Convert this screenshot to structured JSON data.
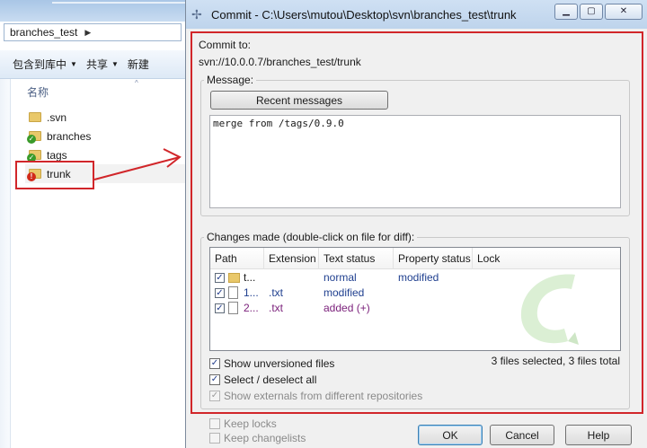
{
  "explorer": {
    "breadcrumb": "branches_test",
    "toolbar": [
      {
        "label": "包含到库中"
      },
      {
        "label": "共享"
      },
      {
        "label": "新建"
      }
    ],
    "column_name": "名称",
    "items": [
      {
        "name": ".svn",
        "status": "none"
      },
      {
        "name": "branches",
        "status": "ok"
      },
      {
        "name": "tags",
        "status": "ok"
      },
      {
        "name": "trunk",
        "status": "modified"
      }
    ]
  },
  "dialog": {
    "title": "Commit - C:\\Users\\mutou\\Desktop\\svn\\branches_test\\trunk",
    "commit_to_label": "Commit to:",
    "commit_url": "svn://10.0.0.7/branches_test/trunk",
    "message_group_label": "Message:",
    "recent_messages_label": "Recent messages",
    "message_text": "merge from /tags/0.9.0",
    "changes_group_label": "Changes made (double-click on file for diff):",
    "columns": [
      "Path",
      "Extension",
      "Text status",
      "Property status",
      "Lock"
    ],
    "rows": [
      {
        "path": "t...",
        "extension": "",
        "text_status": "normal",
        "property_status": "modified",
        "checked": true,
        "icon": "folder-icon"
      },
      {
        "path": "1...",
        "extension": ".txt",
        "text_status": "modified",
        "property_status": "",
        "checked": true,
        "icon": "file-icon"
      },
      {
        "path": "2...",
        "extension": ".txt",
        "text_status": "added (+)",
        "property_status": "",
        "checked": true,
        "icon": "file-icon"
      }
    ],
    "show_unversioned_label": "Show unversioned files",
    "select_all_label": "Select / deselect all",
    "show_externals_label": "Show externals from different repositories",
    "summary": "3 files selected, 3 files total",
    "keep_locks_label": "Keep locks",
    "keep_changelists_label": "Keep changelists",
    "ok_label": "OK",
    "cancel_label": "Cancel",
    "help_label": "Help",
    "window_buttons": {
      "minimize": "▁",
      "maximize": "▢",
      "close": "✕"
    }
  },
  "colors": {
    "highlight_red": "#d1262a",
    "status_blue": "#1f3f8f",
    "status_purple": "#7a1f7a",
    "ok_overlay": "#3a9a2a",
    "modified_overlay": "#d12a1a"
  },
  "checkbox_mark": "✓"
}
